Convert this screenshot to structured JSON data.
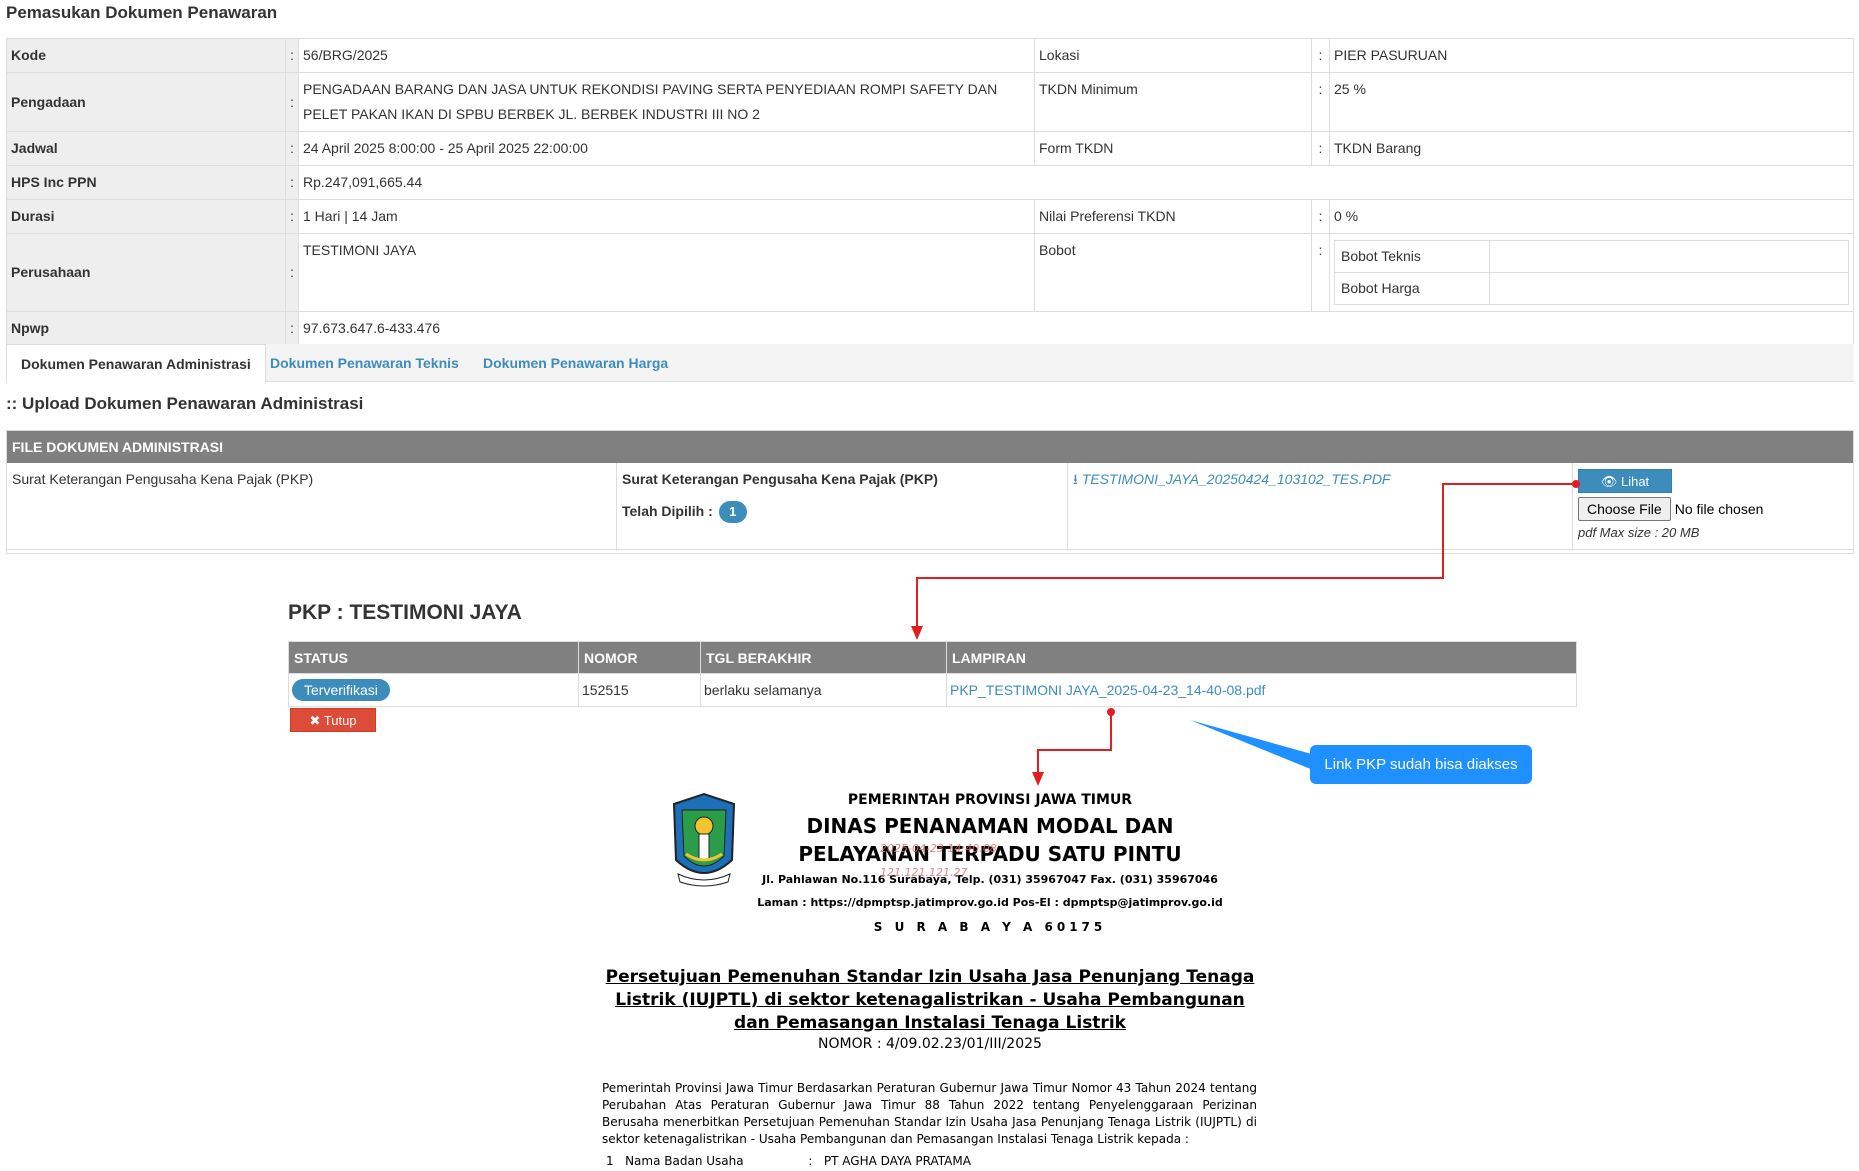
{
  "page_title": "Pemasukan Dokumen Penawaran",
  "info": {
    "kode_label": "Kode",
    "kode_value": "56/BRG/2025",
    "lokasi_label": "Lokasi",
    "lokasi_value": "PIER PASURUAN",
    "pengadaan_label": "Pengadaan",
    "pengadaan_value": "PENGADAAN BARANG DAN JASA UNTUK REKONDISI PAVING SERTA PENYEDIAAN ROMPI SAFETY DAN PELET PAKAN IKAN DI SPBU BERBEK JL. BERBEK INDUSTRI III NO 2",
    "tkdn_min_label": "TKDN Minimum",
    "tkdn_min_value": "25 %",
    "jadwal_label": "Jadwal",
    "jadwal_value": "24 April 2025 8:00:00 - 25 April 2025 22:00:00",
    "form_tkdn_label": "Form TKDN",
    "form_tkdn_value": "TKDN Barang",
    "hps_label": "HPS Inc PPN",
    "hps_value": "Rp.247,091,665.44",
    "durasi_label": "Durasi",
    "durasi_value": "1 Hari | 14 Jam",
    "nilai_pref_label": "Nilai Preferensi TKDN",
    "nilai_pref_value": "0 %",
    "perusahaan_label": "Perusahaan",
    "perusahaan_value": "TESTIMONI JAYA",
    "bobot_label": "Bobot",
    "bobot_teknis": "Bobot Teknis",
    "bobot_harga": "Bobot Harga",
    "npwp_label": "Npwp",
    "npwp_value": "97.673.647.6-433.476",
    "colon": ":"
  },
  "tabs": [
    "Dokumen Penawaran Administrasi",
    "Dokumen Penawaran Teknis",
    "Dokumen Penawaran Harga"
  ],
  "section_title": ":: Upload Dokumen Penawaran Administrasi",
  "file_table": {
    "header": "FILE DOKUMEN ADMINISTRASI",
    "doc_name": "Surat Keterangan Pengusaha Kena Pajak (PKP)",
    "doc_name_bold": "Surat Keterangan Pengusaha Kena Pajak (PKP)",
    "selected_label": "Telah Dipilih :",
    "selected_count": "1",
    "file_link": "TESTIMONI_JAYA_20250424_103102_TES.PDF",
    "view_button": "Lihat",
    "choose_file": "Choose File",
    "no_file": "No file chosen",
    "max_size": "pdf Max size : 20 MB"
  },
  "pkp": {
    "title": "PKP : TESTIMONI JAYA",
    "headers": [
      "STATUS",
      "NOMOR",
      "TGL BERAKHIR",
      "LAMPIRAN"
    ],
    "row": {
      "status": "Terverifikasi",
      "nomor": "152515",
      "tgl_berakhir": "berlaku selamanya",
      "lampiran": "PKP_TESTIMONI JAYA_2025-04-23_14-40-08.pdf"
    },
    "close_button": "Tutup"
  },
  "callout": "Link PKP sudah bisa diakses",
  "document": {
    "line1": "PEMERINTAH PROVINSI JAWA TIMUR",
    "line2": "DINAS PENANAMAN MODAL DAN",
    "line3": "PELAYANAN TERPADU SATU PINTU",
    "line4": "Jl. Pahlawan No.116 Surabaya, Telp. (031) 35967047 Fax. (031) 35967046",
    "line5": "Laman : https://dpmptsp.jatimprov.go.id Pos-El : dpmptsp@jatimprov.go.id",
    "line6": "S U R A B A Y A 60175",
    "watermark_1": "2025-04-23 14:40:08",
    "watermark_2": "121.121.121.27",
    "title": "Persetujuan Pemenuhan Standar Izin Usaha Jasa Penunjang Tenaga Listrik (IUJPTL) di sektor ketenagalistrikan - Usaha Pembangunan dan Pemasangan Instalasi Tenaga Listrik",
    "nomor": "NOMOR : 4/09.02.23/01/III/2025",
    "body": "Pemerintah Provinsi Jawa Timur Berdasarkan Peraturan Gubernur Jawa Timur Nomor 43 Tahun 2024 tentang Perubahan Atas Peraturan Gubernur Jawa Timur 88 Tahun 2022 tentang Penyelenggaraan Perizinan Berusaha menerbitkan Persetujuan Pemenuhan Standar Izin Usaha Jasa Penunjang Tenaga Listrik (IUJPTL) di sektor ketenagalistrikan - Usaha Pembangunan dan Pemasangan Instalasi Tenaga Listrik kepada :",
    "item1": "1   Nama Badan Usaha                 :   PT AGHA DAYA PRATAMA"
  },
  "colors": {
    "accent": "#3c8dbc",
    "header_gray": "#808080",
    "danger": "#dd4b39",
    "annotation_red": "#e02020",
    "callout_blue": "#1e90ff"
  }
}
